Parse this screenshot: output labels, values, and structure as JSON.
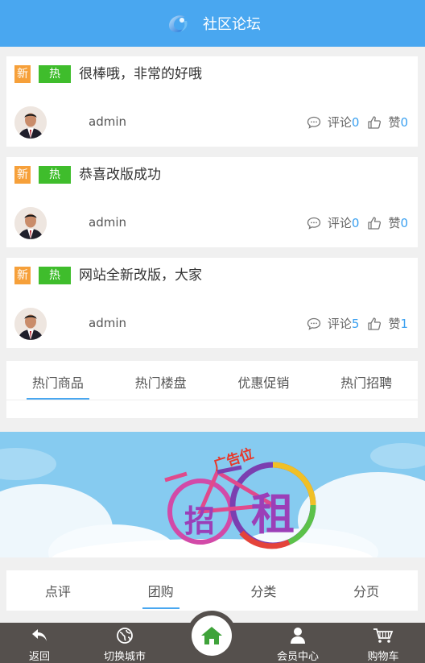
{
  "header": {
    "title": "社区论坛",
    "logo_icon": "swirl-logo-icon"
  },
  "posts": [
    {
      "tag_new": "新",
      "tag_hot": "热",
      "title": "很棒哦，非常的好哦",
      "author": "admin",
      "comment_label": "评论",
      "comment_count": "0",
      "like_label": "赞",
      "like_count": "0"
    },
    {
      "tag_new": "新",
      "tag_hot": "热",
      "title": "恭喜改版成功",
      "author": "admin",
      "comment_label": "评论",
      "comment_count": "0",
      "like_label": "赞",
      "like_count": "0"
    },
    {
      "tag_new": "新",
      "tag_hot": "热",
      "title": "网站全新改版，大家",
      "author": "admin",
      "comment_label": "评论",
      "comment_count": "5",
      "like_label": "赞",
      "like_count": "1"
    }
  ],
  "category_tabs": [
    {
      "label": "热门商品",
      "active": true
    },
    {
      "label": "热门楼盘",
      "active": false
    },
    {
      "label": "优惠促销",
      "active": false
    },
    {
      "label": "热门招聘",
      "active": false
    }
  ],
  "banner": {
    "ad_label": "广告位",
    "left_char": "招",
    "right_char": "租"
  },
  "section_tabs": [
    {
      "label": "点评",
      "active": false
    },
    {
      "label": "团购",
      "active": true
    },
    {
      "label": "分类",
      "active": false
    },
    {
      "label": "分页",
      "active": false
    }
  ],
  "bottom_nav": {
    "back": "返回",
    "switch_city": "切换城市",
    "home_icon": "home-icon",
    "member_center": "会员中心",
    "cart": "购物车"
  },
  "colors": {
    "header_bg": "#49a7f0",
    "tag_new": "#f6a03a",
    "tag_hot": "#3fbd2c",
    "count_blue": "#3aa0f0",
    "bottom_bar": "#55504d",
    "home_green": "#3fa33a"
  }
}
